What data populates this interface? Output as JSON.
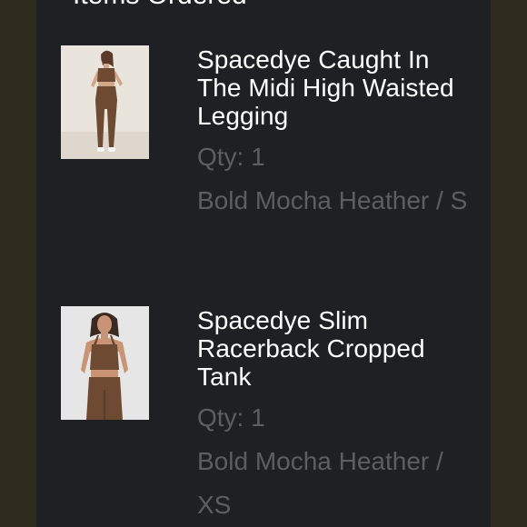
{
  "order": {
    "section_title": "Items Ordered",
    "items": [
      {
        "name": "Spacedye Caught In The Midi High Waisted Legging",
        "qty": "Qty: 1",
        "variant": "Bold Mocha Heather / S",
        "image_icon": "product-photo-legging"
      },
      {
        "name": "Spacedye Slim Racerback Cropped Tank",
        "qty": "Qty: 1",
        "variant": "Bold Mocha Heather / XS",
        "image_icon": "product-photo-tank"
      }
    ]
  },
  "colors": {
    "background": "#2f2b1f",
    "panel": "#1f2023",
    "text_primary": "#ffffff",
    "text_secondary": "#5d5e60",
    "product_brown": "#6e4a33"
  }
}
